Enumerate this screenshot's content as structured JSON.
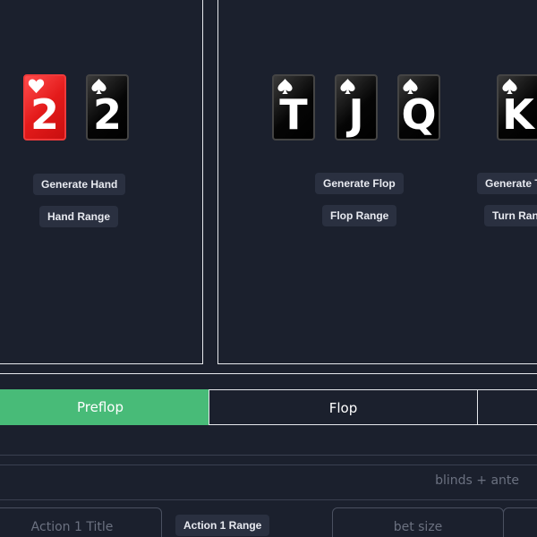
{
  "hand": {
    "cards": [
      {
        "rank": "2",
        "suit": "heart",
        "color": "red"
      },
      {
        "rank": "2",
        "suit": "spade",
        "color": "black"
      }
    ],
    "generate_label": "Generate Hand",
    "range_label": "Hand Range"
  },
  "board": {
    "cards": [
      {
        "rank": "T",
        "suit": "spade",
        "color": "black"
      },
      {
        "rank": "J",
        "suit": "spade",
        "color": "black"
      },
      {
        "rank": "Q",
        "suit": "spade",
        "color": "black"
      },
      {
        "rank": "K",
        "suit": "spade",
        "color": "black"
      }
    ],
    "generate_flop_label": "Generate Flop",
    "flop_range_label": "Flop Range",
    "generate_turn_label": "Generate Turn",
    "turn_range_label": "Turn Range"
  },
  "tabs": [
    {
      "label": "Preflop",
      "active": true
    },
    {
      "label": "Flop",
      "active": false
    },
    {
      "label": "",
      "active": false
    }
  ],
  "blinds_placeholder": "blinds + ante",
  "action": {
    "title_placeholder": "Action 1 Title",
    "range_label": "Action 1 Range",
    "bet_size_placeholder": "bet size"
  },
  "colors": {
    "background": "#1b202d",
    "accent_green": "#48bb78",
    "button_bg": "#2a3040",
    "border": "#e6e8ec",
    "muted_text": "#6b7180"
  }
}
